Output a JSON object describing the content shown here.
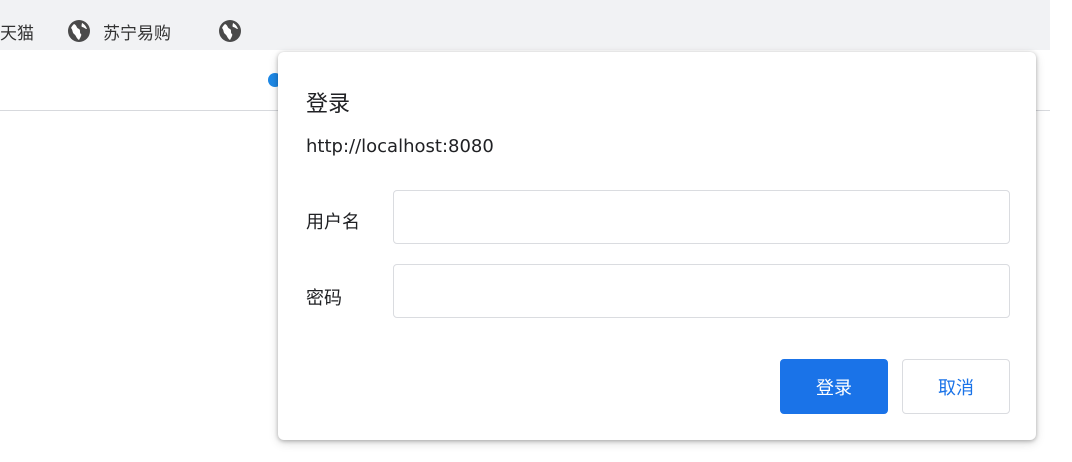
{
  "browser": {
    "bookmarks": [
      {
        "label": "天猫",
        "icon": "globe-icon"
      },
      {
        "label": "苏宁易购",
        "icon": "globe-icon"
      },
      {
        "label": "",
        "icon": "globe-icon"
      }
    ]
  },
  "dialog": {
    "title": "登录",
    "origin": "http://localhost:8080",
    "username_label": "用户名",
    "username_value": "",
    "password_label": "密码",
    "password_value": "",
    "submit_label": "登录",
    "cancel_label": "取消"
  },
  "colors": {
    "accent": "#1a73e8",
    "toolbar_bg": "#f1f2f4"
  }
}
